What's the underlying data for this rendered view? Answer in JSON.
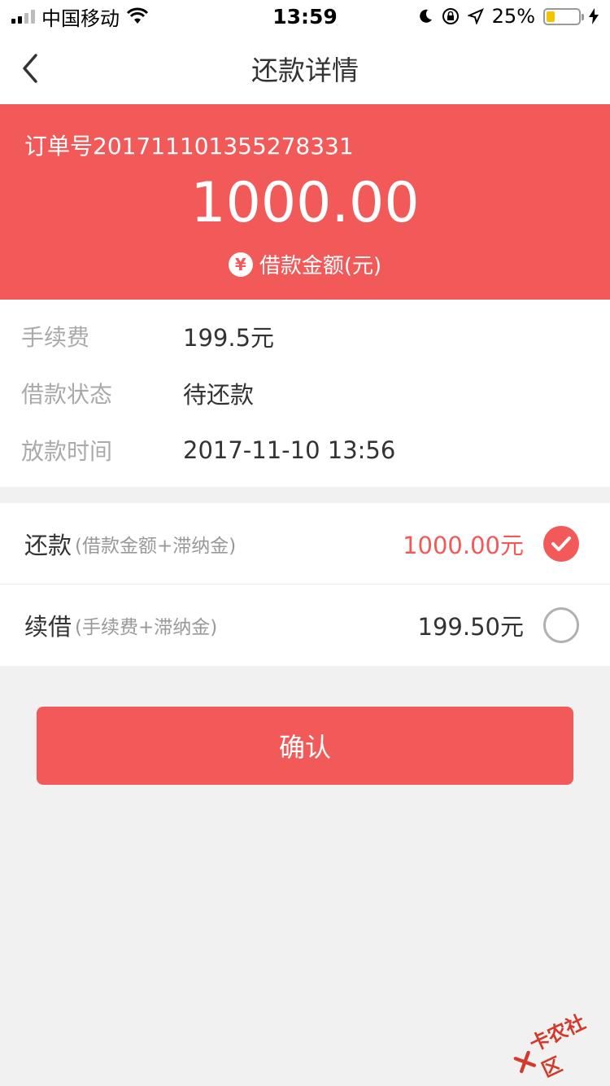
{
  "status_bar": {
    "carrier": "中国移动",
    "time": "13:59",
    "battery_percent": "25%",
    "battery_level": 0.25,
    "battery_color": "#f5c400"
  },
  "nav": {
    "title": "还款详情",
    "back_icon": "chevron-left-icon"
  },
  "order": {
    "order_label": "订单号20171110135527833​1",
    "amount": "1000.00",
    "amount_label": "借款金额(元)",
    "yen_symbol": "¥"
  },
  "details": [
    {
      "label": "手续费",
      "value": "199.5元"
    },
    {
      "label": "借款状态",
      "value": "待还款"
    },
    {
      "label": "放款时间",
      "value": "2017-11-10 13:56"
    }
  ],
  "options": [
    {
      "title": "还款",
      "subtitle": "(借款金额+滞纳金)",
      "amount": "1000.00元",
      "selected": true
    },
    {
      "title": "续借",
      "subtitle": "(手续费+滞纳金)",
      "amount": "199.50元",
      "selected": false
    }
  ],
  "confirm_label": "确认",
  "watermark": "卡农社区",
  "colors": {
    "accent": "#f25a5a",
    "background": "#f1f1f1"
  }
}
